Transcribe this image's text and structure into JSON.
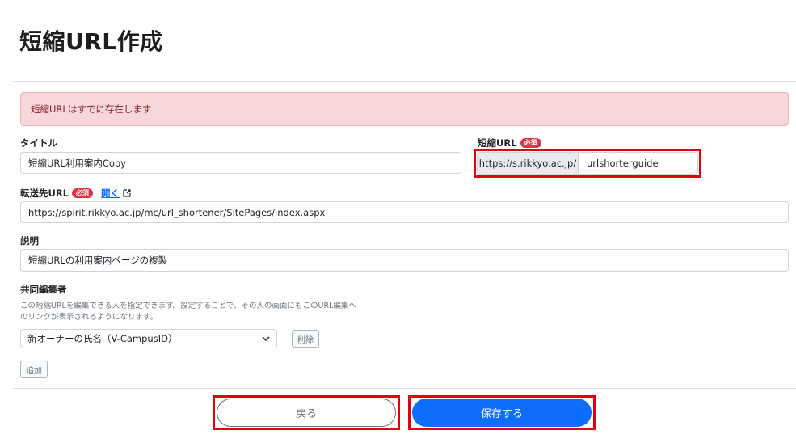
{
  "page": {
    "title": "短縮URL作成"
  },
  "alert": {
    "message": "短縮URLはすでに存在します"
  },
  "form": {
    "title": {
      "label": "タイトル",
      "value": "短縮URL利用案内Copy"
    },
    "short_url": {
      "label": "短縮URL",
      "required_badge": "必須",
      "prefix": "https://s.rikkyo.ac.jp/",
      "value": "urlshorterguide"
    },
    "redirect_url": {
      "label": "転送先URL",
      "required_badge": "必須",
      "open_link": "開く",
      "value": "https://spirit.rikkyo.ac.jp/mc/url_shortener/SitePages/index.aspx"
    },
    "description": {
      "label": "説明",
      "value": "短縮URLの利用案内ページの複製"
    },
    "co_editors": {
      "label": "共同編集者",
      "help_line1": "この短縮URLを編集できる人を指定できます。設定することで、その人の画面にもこのURL編集へ",
      "help_line2": "のリンクが表示されるようになります。",
      "select_value": "新オーナーの氏名（V-CampusID）",
      "delete_button": "削除",
      "add_button": "追加"
    }
  },
  "footer": {
    "back_button": "戻る",
    "save_button": "保存する"
  },
  "colors": {
    "accent": "#0d6efd",
    "danger": "#dc3545",
    "highlight": "#e3000f",
    "alert_bg": "#f8d7da"
  }
}
